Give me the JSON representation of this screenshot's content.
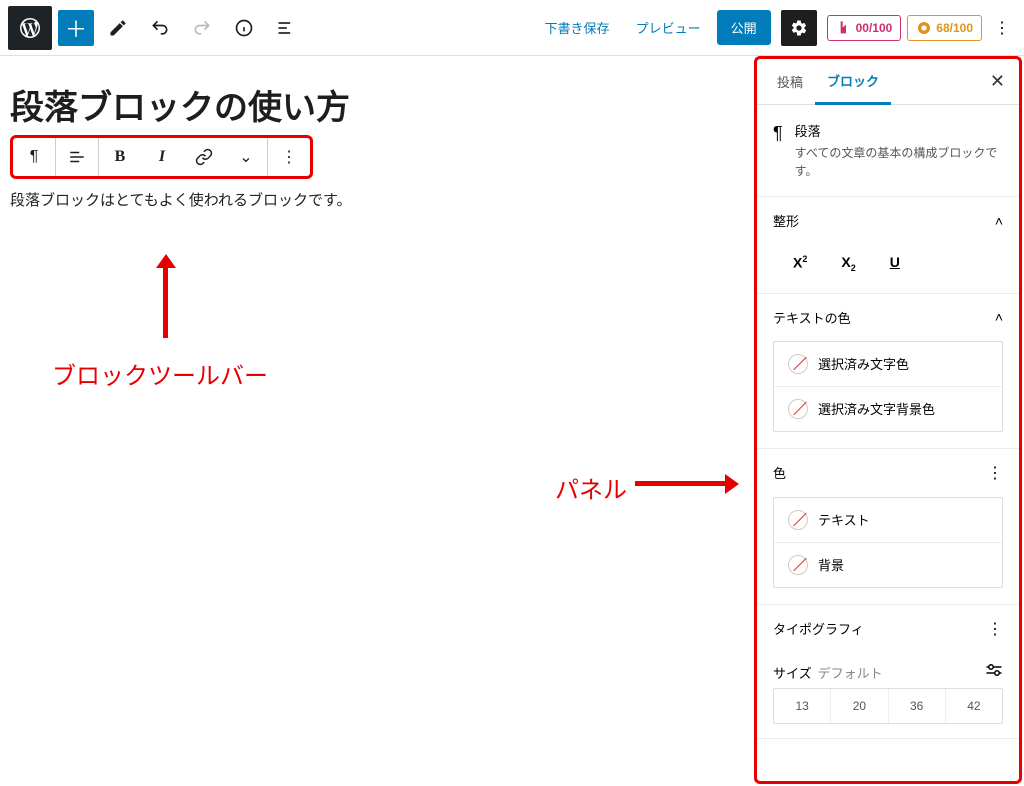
{
  "topbar": {
    "draft_save": "下書き保存",
    "preview": "プレビュー",
    "publish": "公開",
    "score1": "00/100",
    "score2": "68/100"
  },
  "editor": {
    "title": "段落ブロックの使い方",
    "paragraph": "段落ブロックはとてもよく使われるブロックです。"
  },
  "annotations": {
    "toolbar_label": "ブロックツールバー",
    "panel_label": "パネル"
  },
  "sidebar": {
    "tabs": {
      "post": "投稿",
      "block": "ブロック"
    },
    "block_name": "段落",
    "block_desc": "すべての文章の基本の構成ブロックです。",
    "sections": {
      "format": "整形",
      "text_color": "テキストの色",
      "text_color_opts": {
        "fg": "選択済み文字色",
        "bg": "選択済み文字背景色"
      },
      "color": "色",
      "color_opts": {
        "text": "テキスト",
        "background": "背景"
      },
      "typography": "タイポグラフィ",
      "size_label": "サイズ",
      "size_default": "デフォルト",
      "size_opts": [
        "13",
        "20",
        "36",
        "42"
      ]
    }
  }
}
